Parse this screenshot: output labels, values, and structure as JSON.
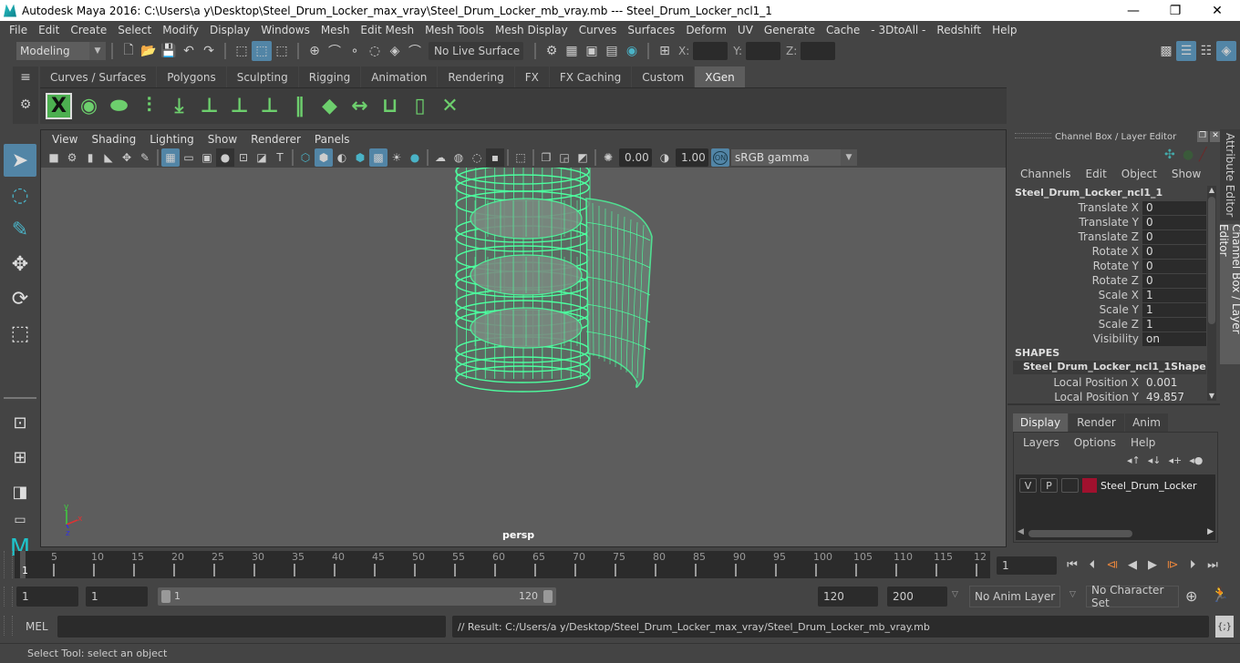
{
  "window": {
    "title": "Autodesk Maya 2016: C:\\Users\\a y\\Desktop\\Steel_Drum_Locker_max_vray\\Steel_Drum_Locker_mb_vray.mb   ---   Steel_Drum_Locker_ncl1_1",
    "minimize": "—",
    "restore": "❐",
    "close": "✕"
  },
  "menubar": [
    "File",
    "Edit",
    "Create",
    "Select",
    "Modify",
    "Display",
    "Windows",
    "Mesh",
    "Edit Mesh",
    "Mesh Tools",
    "Mesh Display",
    "Curves",
    "Surfaces",
    "Deform",
    "UV",
    "Generate",
    "Cache",
    "- 3DtoAll -",
    "Redshift",
    "Help"
  ],
  "toolbar": {
    "mode": "Modeling",
    "live_surface": "No Live Surface",
    "x_label": "X:",
    "y_label": "Y:",
    "z_label": "Z:",
    "x_value": "",
    "y_value": "",
    "z_value": ""
  },
  "shelf": {
    "tabs": [
      "Curves / Surfaces",
      "Polygons",
      "Sculpting",
      "Rigging",
      "Animation",
      "Rendering",
      "FX",
      "FX Caching",
      "Custom",
      "XGen"
    ],
    "active_tab": "XGen",
    "icons": [
      "xgen-window-icon",
      "xgen-preview-icon",
      "xgen-clear-preview-icon",
      "xgen-add-guide-icon",
      "xgen-sculpt-guide-icon",
      "xgen-add-guide-plus-icon",
      "xgen-guide-visibility-icon",
      "xgen-guide-lock-icon",
      "xgen-guide-split-icon",
      "xgen-density-icon",
      "xgen-length-icon",
      "xgen-select-guide-icon",
      "xgen-guide-frame-icon",
      "xgen-delete-guide-icon"
    ]
  },
  "viewport": {
    "menus": [
      "View",
      "Shading",
      "Lighting",
      "Show",
      "Renderer",
      "Panels"
    ],
    "exposure": "0.00",
    "gamma": "1.00",
    "color_mgmt_badge": "ON",
    "colorspace": "sRGB gamma",
    "camera_label": "persp",
    "axis": {
      "x": "x",
      "y": "y",
      "z": "z"
    },
    "wire_color": "#4dff9f"
  },
  "channel_box": {
    "panel_title": "Channel Box / Layer Editor",
    "menus": [
      "Channels",
      "Edit",
      "Object",
      "Show"
    ],
    "object_name": "Steel_Drum_Locker_ncl1_1",
    "channels": [
      {
        "label": "Translate X",
        "value": "0"
      },
      {
        "label": "Translate Y",
        "value": "0"
      },
      {
        "label": "Translate Z",
        "value": "0"
      },
      {
        "label": "Rotate X",
        "value": "0"
      },
      {
        "label": "Rotate Y",
        "value": "0"
      },
      {
        "label": "Rotate Z",
        "value": "0"
      },
      {
        "label": "Scale X",
        "value": "1"
      },
      {
        "label": "Scale Y",
        "value": "1"
      },
      {
        "label": "Scale Z",
        "value": "1"
      },
      {
        "label": "Visibility",
        "value": "on"
      }
    ],
    "shapes_header": "SHAPES",
    "shape_name": "Steel_Drum_Locker_ncl1_1Shape",
    "shape_channels": [
      {
        "label": "Local Position X",
        "value": "0.001"
      },
      {
        "label": "Local Position Y",
        "value": "49.857"
      }
    ]
  },
  "layer_editor": {
    "tabs": [
      "Display",
      "Render",
      "Anim"
    ],
    "active_tab": "Display",
    "menus": [
      "Layers",
      "Options",
      "Help"
    ],
    "layers": [
      {
        "v": "V",
        "p": "P",
        "name": "Steel_Drum_Locker",
        "color": "#a0112e"
      }
    ]
  },
  "side_tabs": [
    "Attribute Editor",
    "Channel Box / Layer Editor"
  ],
  "timeline": {
    "ticks": [
      "5",
      "10",
      "15",
      "20",
      "25",
      "30",
      "35",
      "40",
      "45",
      "50",
      "55",
      "60",
      "65",
      "70",
      "75",
      "80",
      "85",
      "90",
      "95",
      "100",
      "105",
      "110",
      "115",
      "12"
    ],
    "current_frame_marker": "1",
    "current_frame": "1"
  },
  "range": {
    "start": "1",
    "playback_start": "1",
    "slider_start": "1",
    "slider_end": "120",
    "playback_end": "120",
    "end": "200",
    "anim_layer": "No Anim Layer",
    "character_set": "No Character Set"
  },
  "command_line": {
    "label": "MEL",
    "input": "",
    "result": "// Result: C:/Users/a y/Desktop/Steel_Drum_Locker_max_vray/Steel_Drum_Locker_mb_vray.mb"
  },
  "status_line": "Select Tool: select an object"
}
